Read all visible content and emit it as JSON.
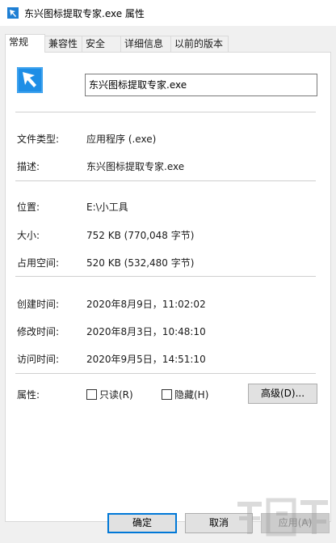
{
  "window": {
    "title": "东兴图标提取专家.exe 属性"
  },
  "tabs": [
    {
      "label": "常规"
    },
    {
      "label": "兼容性"
    },
    {
      "label": "安全"
    },
    {
      "label": "详细信息"
    },
    {
      "label": "以前的版本"
    }
  ],
  "general": {
    "file_name": "东兴图标提取专家.exe",
    "file_type_label": "文件类型:",
    "file_type_value": "应用程序 (.exe)",
    "description_label": "描述:",
    "description_value": "东兴图标提取专家.exe",
    "location_label": "位置:",
    "location_value": "E:\\小工具",
    "size_label": "大小:",
    "size_value": "752 KB (770,048 字节)",
    "size_on_disk_label": "占用空间:",
    "size_on_disk_value": "520 KB (532,480 字节)",
    "created_label": "创建时间:",
    "created_value": "2020年8月9日，11:02:02",
    "modified_label": "修改时间:",
    "modified_value": "2020年8月3日，10:48:10",
    "accessed_label": "访问时间:",
    "accessed_value": "2020年9月5日，14:51:10",
    "attributes_label": "属性:",
    "readonly_label": "只读(R)",
    "hidden_label": "隐藏(H)",
    "advanced_button": "高级(D)..."
  },
  "footer": {
    "ok": "确定",
    "cancel": "取消",
    "apply": "应用(A)"
  },
  "icons": {
    "app_icon": "arrow-cursor-icon"
  },
  "colors": {
    "icon_blue": "#1e90e0",
    "accent": "#0078d7"
  }
}
